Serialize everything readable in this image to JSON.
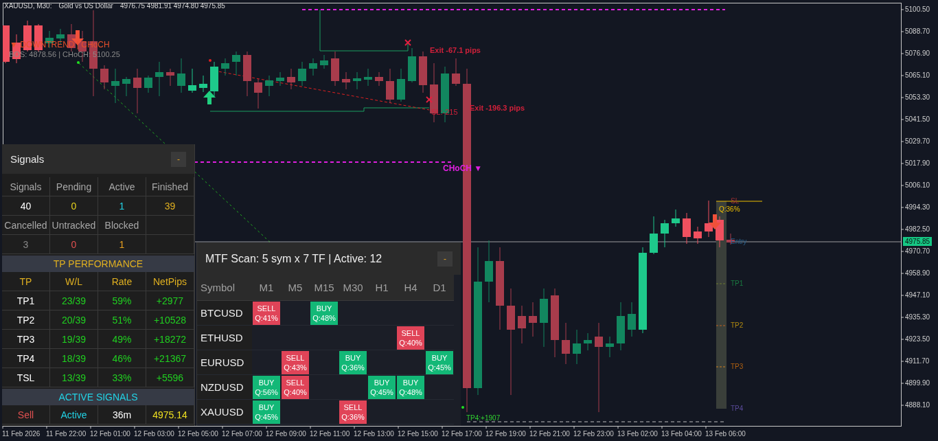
{
  "header": {
    "symbol": "XAUUSD, M30:",
    "description": "Gold vs US Dollar",
    "ohlc": "4976.75 4981.91 4974.80 4975.85"
  },
  "chart": {
    "annotations": [
      {
        "kind": "trend",
        "text": "▼ DOWNTREND | CHoCH"
      },
      {
        "kind": "structure",
        "text": "BOS: 4878.56  |  CHoCH: 5100.25"
      },
      {
        "kind": "exit",
        "text": "Exit -67.1 pips"
      },
      {
        "kind": "stop",
        "text": "SL:-215"
      },
      {
        "kind": "exit",
        "text": "Exit -196.3 pips"
      },
      {
        "kind": "choch",
        "text": "CHoCH ▼"
      },
      {
        "kind": "tp_hit",
        "text": "TP4:+1907"
      }
    ],
    "trade": {
      "quality": "Q:36%",
      "levels": [
        {
          "label": "SL",
          "color": "#a83232"
        },
        {
          "label": "Entry",
          "color": "#2a5f8a"
        },
        {
          "label": "TP1",
          "color": "#1a7a40"
        },
        {
          "label": "TP2",
          "color": "#b08a10"
        },
        {
          "label": "TP3",
          "color": "#b06010"
        },
        {
          "label": "TP4",
          "color": "#5a4a9a"
        }
      ]
    }
  },
  "price_axis": {
    "ticks": [
      "5100.50",
      "5088.70",
      "5076.90",
      "5065.10",
      "5053.30",
      "5041.50",
      "5029.70",
      "5017.90",
      "5006.10",
      "4994.30",
      "4982.50",
      "4970.70",
      "4958.90",
      "4947.10",
      "4935.30",
      "4923.50",
      "4911.70",
      "4899.90",
      "4888.10"
    ],
    "current_price": "4975.85"
  },
  "time_axis": {
    "labels": [
      "11 Feb 2026",
      "11 Feb 22:00",
      "12 Feb 01:00",
      "12 Feb 03:00",
      "12 Feb 05:00",
      "12 Feb 07:00",
      "12 Feb 09:00",
      "12 Feb 11:00",
      "12 Feb 13:00",
      "12 Feb 15:00",
      "12 Feb 17:00",
      "12 Feb 19:00",
      "12 Feb 21:00",
      "12 Feb 23:00",
      "13 Feb 02:00",
      "13 Feb 04:00",
      "13 Feb 06:00"
    ]
  },
  "signals_panel": {
    "title": "Signals",
    "minimize": "-",
    "stats": [
      {
        "label": "Signals",
        "value": "40",
        "color": "#ffffff"
      },
      {
        "label": "Pending",
        "value": "0",
        "color": "#e6d21e"
      },
      {
        "label": "Active",
        "value": "1",
        "color": "#22d3e6"
      },
      {
        "label": "Finished",
        "value": "39",
        "color": "#e0b020"
      },
      {
        "label": "Cancelled",
        "value": "3",
        "color": "#888888"
      },
      {
        "label": "Untracked",
        "value": "0",
        "color": "#e05050"
      },
      {
        "label": "Blocked",
        "value": "1",
        "color": "#e8a020"
      }
    ],
    "tp_performance": {
      "title": "TP PERFORMANCE",
      "columns": [
        "TP",
        "W/L",
        "Rate",
        "NetPips"
      ],
      "rows": [
        {
          "tp": "TP1",
          "wl": "23/39",
          "rate": "59%",
          "net_pips": "+2977"
        },
        {
          "tp": "TP2",
          "wl": "20/39",
          "rate": "51%",
          "net_pips": "+10528"
        },
        {
          "tp": "TP3",
          "wl": "19/39",
          "rate": "49%",
          "net_pips": "+18272"
        },
        {
          "tp": "TP4",
          "wl": "18/39",
          "rate": "46%",
          "net_pips": "+21367"
        },
        {
          "tp": "TSL",
          "wl": "13/39",
          "rate": "33%",
          "net_pips": "+5596"
        }
      ]
    },
    "active_signals": {
      "title": "ACTIVE SIGNALS",
      "cells": [
        {
          "text": "Sell",
          "color": "#e05050"
        },
        {
          "text": "Active",
          "color": "#22d3e6"
        },
        {
          "text": "36m",
          "color": "#ffffff"
        },
        {
          "text": "4975.14",
          "color": "#f0e020"
        }
      ]
    }
  },
  "mtf_panel": {
    "title": "MTF Scan: 5 sym x 7 TF | Active: 12",
    "minimize": "-",
    "symbol_header": "Symbol",
    "timeframes": [
      "M1",
      "M5",
      "M15",
      "M30",
      "H1",
      "H4",
      "D1"
    ],
    "rows": [
      {
        "symbol": "BTCUSD",
        "cells": [
          {
            "kind": "sell",
            "signal": "SELL",
            "quality": "Q:41%"
          },
          {
            "kind": "empty"
          },
          {
            "kind": "buy",
            "signal": "BUY",
            "quality": "Q:48%"
          },
          {
            "kind": "empty"
          },
          {
            "kind": "empty"
          },
          {
            "kind": "empty"
          },
          {
            "kind": "empty"
          }
        ]
      },
      {
        "symbol": "ETHUSD",
        "cells": [
          {
            "kind": "empty"
          },
          {
            "kind": "empty"
          },
          {
            "kind": "empty"
          },
          {
            "kind": "empty"
          },
          {
            "kind": "empty"
          },
          {
            "kind": "sell",
            "signal": "SELL",
            "quality": "Q:40%"
          },
          {
            "kind": "empty"
          }
        ]
      },
      {
        "symbol": "EURUSD",
        "cells": [
          {
            "kind": "empty"
          },
          {
            "kind": "sell",
            "signal": "SELL",
            "quality": "Q:43%"
          },
          {
            "kind": "empty"
          },
          {
            "kind": "buy",
            "signal": "BUY",
            "quality": "Q:36%"
          },
          {
            "kind": "empty"
          },
          {
            "kind": "empty"
          },
          {
            "kind": "buy",
            "signal": "BUY",
            "quality": "Q:45%"
          }
        ]
      },
      {
        "symbol": "NZDUSD",
        "cells": [
          {
            "kind": "buy",
            "signal": "BUY",
            "quality": "Q:56%"
          },
          {
            "kind": "sell",
            "signal": "SELL",
            "quality": "Q:40%"
          },
          {
            "kind": "empty"
          },
          {
            "kind": "empty"
          },
          {
            "kind": "buy",
            "signal": "BUY",
            "quality": "Q:45%"
          },
          {
            "kind": "buy",
            "signal": "BUY",
            "quality": "Q:48%"
          },
          {
            "kind": "empty"
          }
        ]
      },
      {
        "symbol": "XAUUSD",
        "cells": [
          {
            "kind": "buy",
            "signal": "BUY",
            "quality": "Q:45%"
          },
          {
            "kind": "empty"
          },
          {
            "kind": "empty"
          },
          {
            "kind": "sell",
            "signal": "SELL",
            "quality": "Q:36%"
          },
          {
            "kind": "empty"
          },
          {
            "kind": "empty"
          },
          {
            "kind": "empty"
          }
        ]
      }
    ]
  }
}
